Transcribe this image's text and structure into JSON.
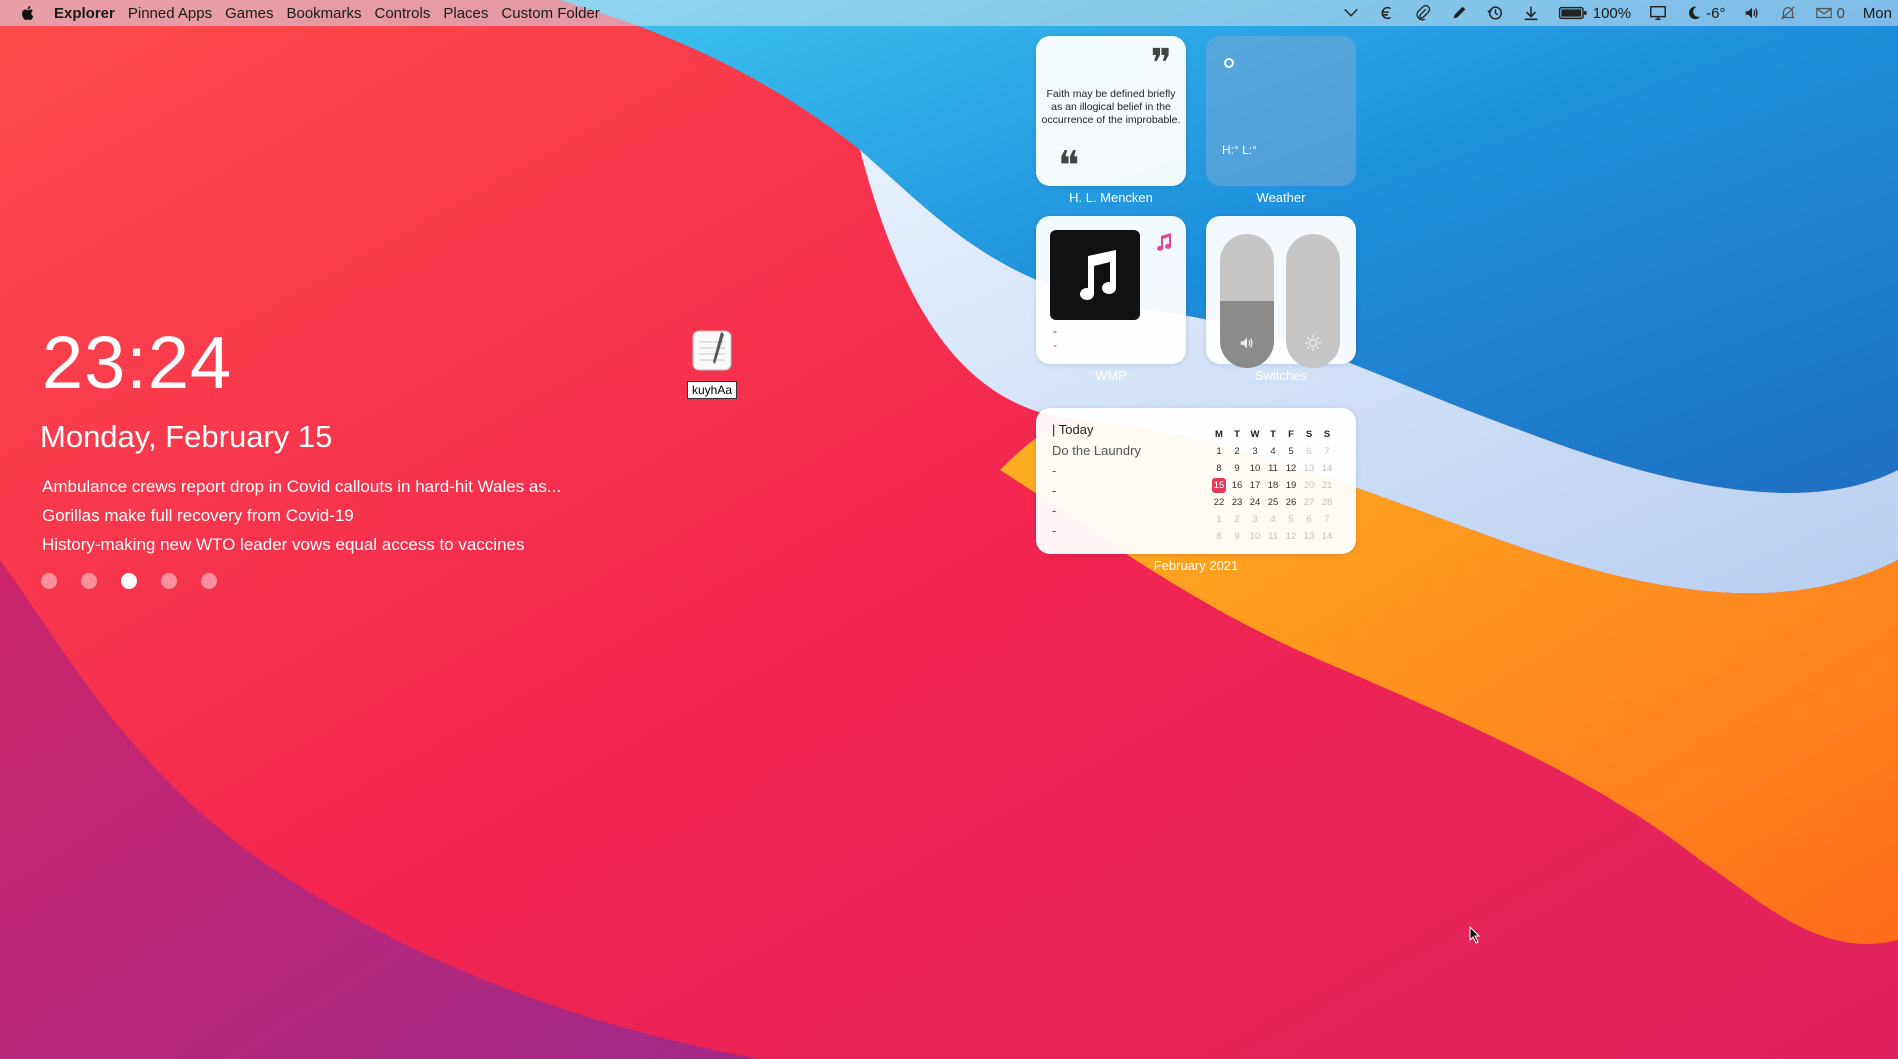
{
  "menubar": {
    "apple_icon": "apple-logo-icon",
    "items": [
      "Explorer",
      "Pinned Apps",
      "Games",
      "Bookmarks",
      "Controls",
      "Places",
      "Custom Folder"
    ],
    "tray": {
      "battery": "100%",
      "weather_temp": "-6°",
      "mail_count": "0",
      "day": "Mon"
    }
  },
  "lockscreen": {
    "time": "23:24",
    "date": "Monday, February 15",
    "news": [
      "Ambulance crews report drop in Covid callouts in hard-hit Wales as...",
      "Gorillas make full recovery from Covid-19",
      "History-making new WTO leader vows equal access to vaccines"
    ],
    "page_dots": 5,
    "active_dot": 3
  },
  "desktop_icon": {
    "label": "kuyhAa",
    "icon": "notepad-icon"
  },
  "widgets": {
    "quote": {
      "text": "Faith may be defined briefly as an illogical belief in the occurrence of the improbable.",
      "author": "H. L. Mencken",
      "open_mark": "❞",
      "close_mark": "❝"
    },
    "weather": {
      "caption": "Weather",
      "hl": "H:° L:°"
    },
    "wmp": {
      "caption": "WMP",
      "track": "-",
      "artist": "-"
    },
    "switches": {
      "caption": "Switches",
      "volume_level": 0.5,
      "brightness_level": 0.0
    },
    "calendar": {
      "caption": "February 2021",
      "today_label": "| Today",
      "task": "Do the Laundry",
      "empty_slots": [
        "-",
        "-",
        "-",
        "-"
      ],
      "weekdays": [
        "M",
        "T",
        "W",
        "T",
        "F",
        "S",
        "S"
      ],
      "weeks": [
        [
          "1",
          "2",
          "3",
          "4",
          "5",
          "6",
          "7"
        ],
        [
          "8",
          "9",
          "10",
          "11",
          "12",
          "13",
          "14"
        ],
        [
          "15",
          "16",
          "17",
          "18",
          "19",
          "20",
          "21"
        ],
        [
          "22",
          "23",
          "24",
          "25",
          "26",
          "27",
          "28"
        ],
        [
          "1",
          "2",
          "3",
          "4",
          "5",
          "6",
          "7"
        ],
        [
          "8",
          "9",
          "10",
          "11",
          "12",
          "13",
          "14"
        ]
      ],
      "today": "15"
    }
  },
  "colors": {
    "accent": "#e23a57",
    "wallpaper_red": "#f2365a",
    "wallpaper_orange": "#ff8a1e",
    "wallpaper_blue": "#2a8ed8"
  }
}
